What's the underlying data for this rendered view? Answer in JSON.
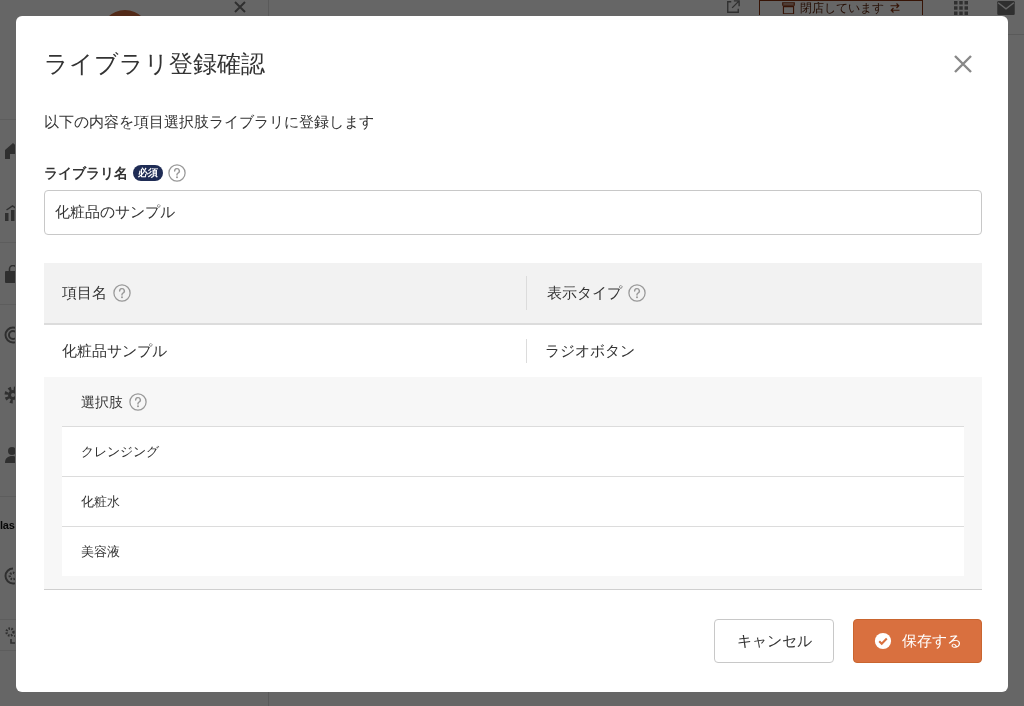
{
  "background": {
    "store_status": "閉店しています",
    "sidebar_section": "las"
  },
  "dialog": {
    "title": "ライブラリ登録確認",
    "description": "以下の内容を項目選択肢ライブラリに登録します",
    "library_name": {
      "label": "ライブラリ名",
      "badge": "必須",
      "value": "化粧品のサンプル"
    },
    "table": {
      "columns": [
        "項目名",
        "表示タイプ"
      ],
      "rows": [
        {
          "cells": [
            "化粧品サンプル",
            "ラジオボタン"
          ],
          "options": {
            "heading": "選択肢",
            "items": [
              "クレンジング",
              "化粧水",
              "美容液"
            ]
          }
        }
      ]
    },
    "buttons": [
      {
        "label": "キャンセル",
        "kind": "secondary"
      },
      {
        "label": "保存する",
        "kind": "primary"
      }
    ]
  }
}
